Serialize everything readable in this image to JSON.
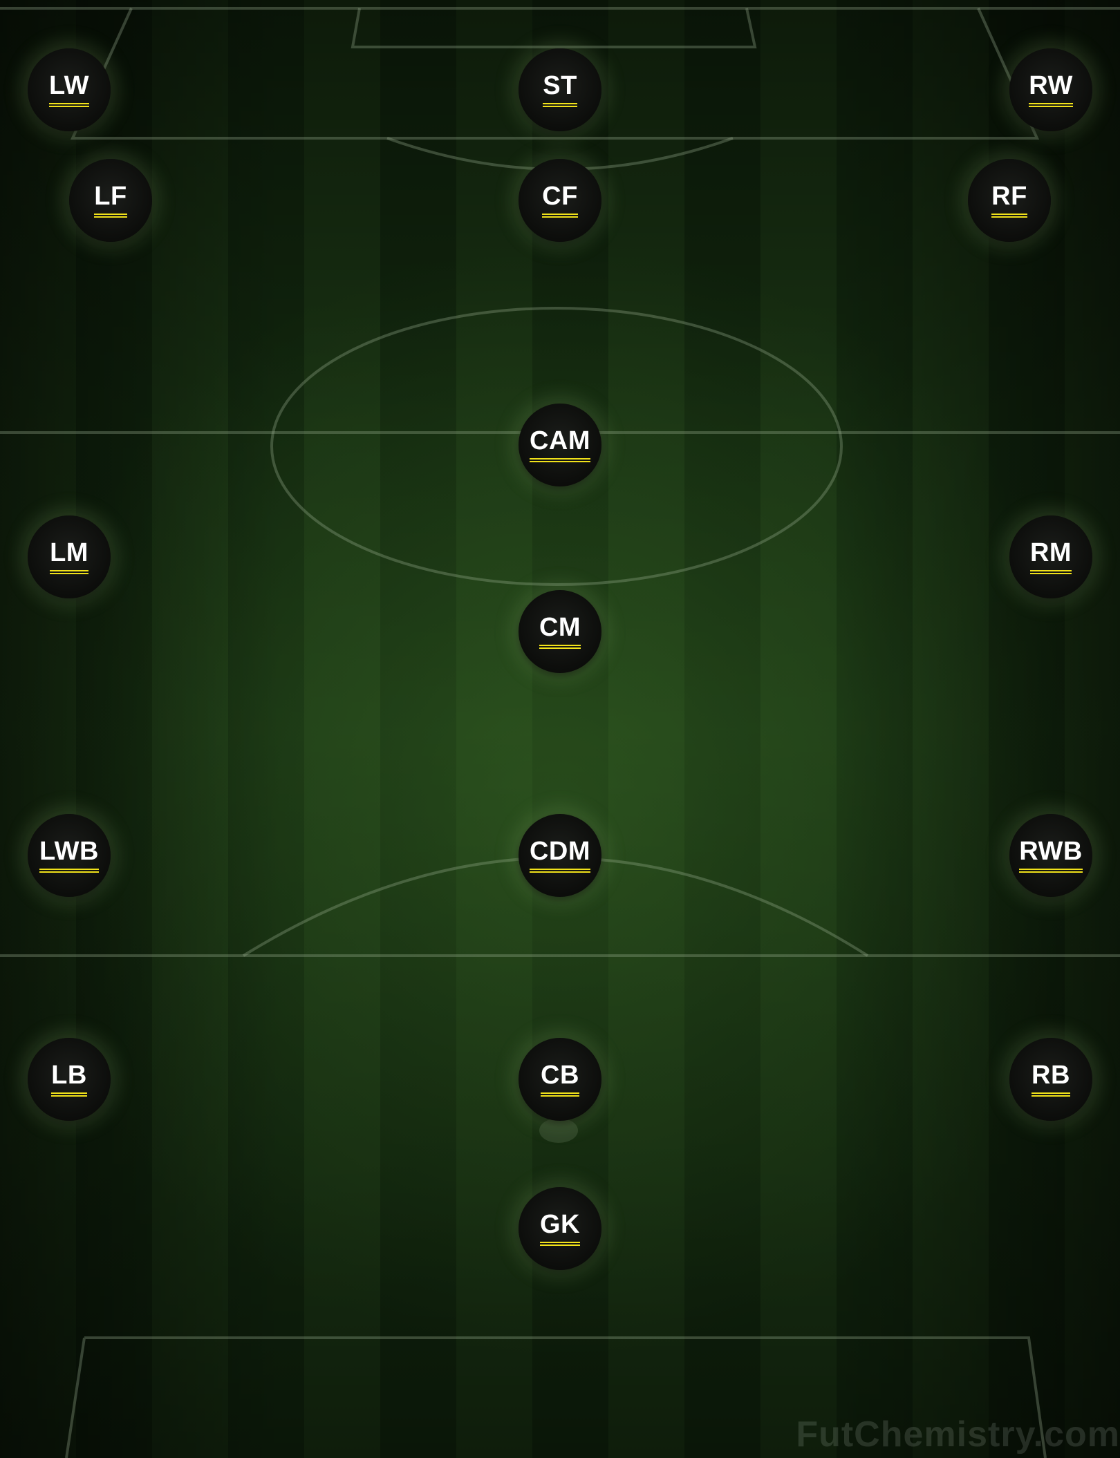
{
  "positions": [
    {
      "id": "lw",
      "label": "LW"
    },
    {
      "id": "st",
      "label": "ST"
    },
    {
      "id": "rw",
      "label": "RW"
    },
    {
      "id": "lf",
      "label": "LF"
    },
    {
      "id": "cf",
      "label": "CF"
    },
    {
      "id": "rf",
      "label": "RF"
    },
    {
      "id": "cam",
      "label": "CAM"
    },
    {
      "id": "lm",
      "label": "LM"
    },
    {
      "id": "rm",
      "label": "RM"
    },
    {
      "id": "cm",
      "label": "CM"
    },
    {
      "id": "lwb",
      "label": "LWB"
    },
    {
      "id": "cdm",
      "label": "CDM"
    },
    {
      "id": "rwb",
      "label": "RWB"
    },
    {
      "id": "lb",
      "label": "LB"
    },
    {
      "id": "cb",
      "label": "CB"
    },
    {
      "id": "rb",
      "label": "RB"
    },
    {
      "id": "gk",
      "label": "GK"
    }
  ],
  "watermark": "FutChemistry.com",
  "colors": {
    "label_text": "#ffffff",
    "label_underline": "#f1e21a",
    "slot_background": "#0c0d0b"
  }
}
